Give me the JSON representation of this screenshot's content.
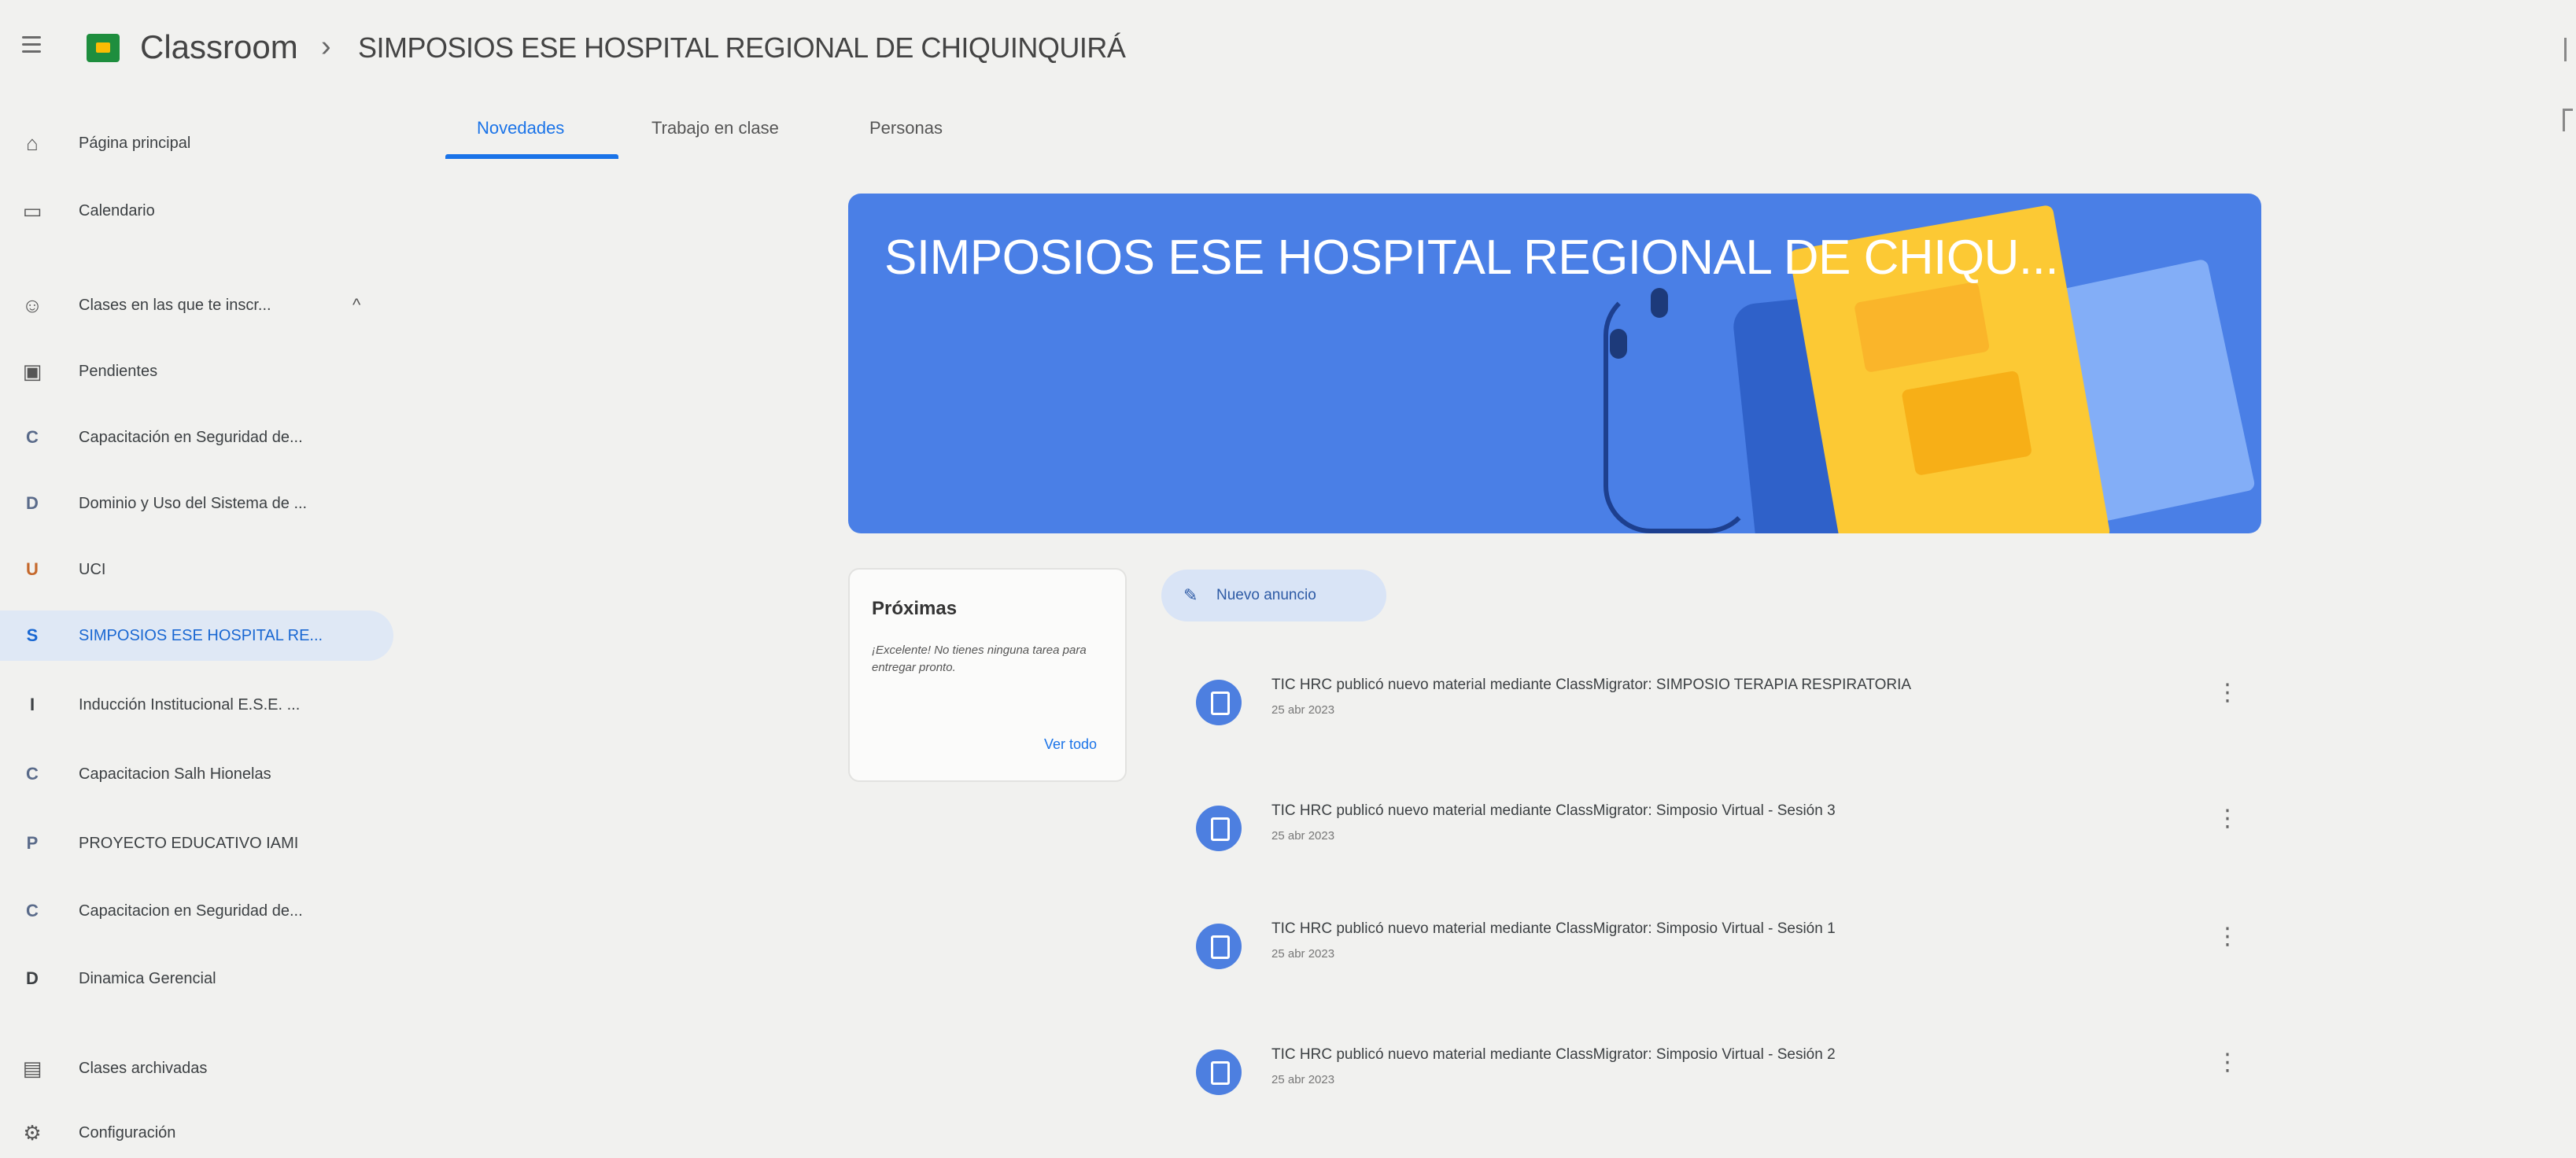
{
  "topbar": {
    "brand": "Classroom",
    "separator": "›",
    "course": "SIMPOSIOS ESE HOSPITAL REGIONAL DE CHIQUINQUIRÁ"
  },
  "tabs": [
    {
      "label": "Novedades",
      "active": true
    },
    {
      "label": "Trabajo en clase",
      "active": false
    },
    {
      "label": "Personas",
      "active": false
    }
  ],
  "sidebar": {
    "items": [
      {
        "icon": "home-icon",
        "glyph": "⌂",
        "label": "Página principal"
      },
      {
        "icon": "calendar-icon",
        "glyph": "▭",
        "label": "Calendario"
      },
      {
        "icon": "school-icon",
        "glyph": "☺",
        "label": "Clases en las que te inscr...",
        "chevron": "^"
      },
      {
        "icon": "pending-icon",
        "glyph": "▣",
        "label": "Pendientes"
      },
      {
        "letter": "C",
        "color": "#5a6b8a",
        "label": "Capacitación en Seguridad de..."
      },
      {
        "letter": "D",
        "color": "#5a6b8a",
        "label": "Dominio y Uso del Sistema de ..."
      },
      {
        "letter": "U",
        "color": "#c5682b",
        "label": "UCI"
      },
      {
        "letter": "S",
        "color": "#1967d2",
        "label": "SIMPOSIOS ESE HOSPITAL RE...",
        "selected": true
      },
      {
        "letter": "I",
        "color": "#3c4043",
        "label": "Inducción Institucional E.S.E. ..."
      },
      {
        "letter": "C",
        "color": "#5a6b8a",
        "label": "Capacitacion Salh Hionelas"
      },
      {
        "letter": "P",
        "color": "#5a6b8a",
        "label": "PROYECTO EDUCATIVO IAMI"
      },
      {
        "letter": "C",
        "color": "#5a6b8a",
        "label": "Capacitacion en Seguridad de..."
      },
      {
        "letter": "D",
        "color": "#3c4043",
        "label": "Dinamica Gerencial"
      },
      {
        "icon": "archive-icon",
        "glyph": "▤",
        "label": "Clases archivadas"
      },
      {
        "icon": "gear-icon",
        "glyph": "⚙",
        "label": "Configuración"
      }
    ]
  },
  "banner": {
    "title": "SIMPOSIOS ESE HOSPITAL REGIONAL DE CHIQU...",
    "color": "#4a7fe6"
  },
  "upcoming": {
    "title": "Próximas",
    "message": "¡Excelente! No tienes ninguna tarea para entregar pronto.",
    "link": "Ver todo"
  },
  "announce_button": "Nuevo anuncio",
  "posts": [
    {
      "text": "TIC HRC publicó nuevo material mediante ClassMigrator: SIMPOSIO TERAPIA RESPIRATORIA",
      "date": "25 abr 2023"
    },
    {
      "text": "TIC HRC publicó nuevo material mediante ClassMigrator: Simposio Virtual - Sesión 3",
      "date": "25 abr 2023"
    },
    {
      "text": "TIC HRC publicó nuevo material mediante ClassMigrator: Simposio Virtual - Sesión 1",
      "date": "25 abr 2023"
    },
    {
      "text": "TIC HRC publicó nuevo material mediante ClassMigrator: Simposio Virtual - Sesión 2",
      "date": "25 abr 2023"
    }
  ],
  "menu_glyph": "⋮",
  "accent": "#1a73e8"
}
